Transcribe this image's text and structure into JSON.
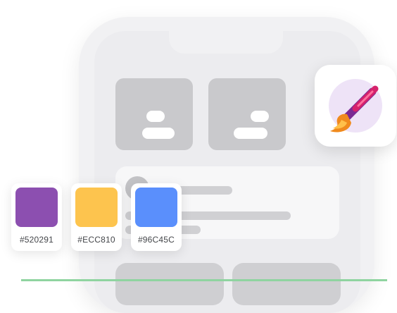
{
  "swatches": [
    {
      "label": "#520291",
      "color": "#8c4fb0"
    },
    {
      "label": "#ECC810",
      "color": "#fdc44e"
    },
    {
      "label": "#96C45C",
      "color": "#5a8ffc"
    }
  ],
  "icons": {
    "app": "paintbrush-icon"
  },
  "colors": {
    "phone_frame": "#f1f1f3",
    "widget": "#c9c9cc",
    "accent_line": "#8fd4a0"
  }
}
